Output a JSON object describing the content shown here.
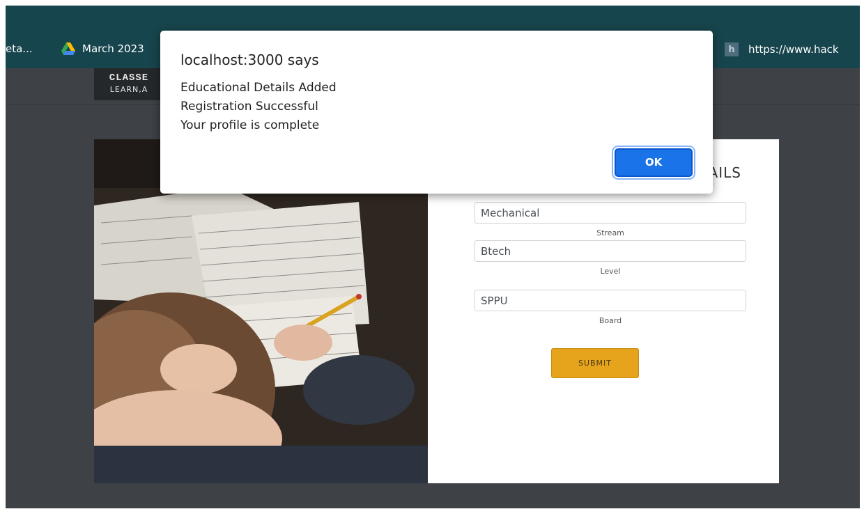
{
  "bookmarks": [
    {
      "label": "eta..."
    },
    {
      "label": "March 2023",
      "icon": "google-drive-icon"
    },
    {
      "label": "https://www.hack",
      "icon": "hackerrank-icon",
      "icon_letter": "h"
    }
  ],
  "logo": {
    "title": "CLASSE",
    "subtitle": "LEARN,A"
  },
  "form": {
    "heading": "AILS",
    "fields": [
      {
        "value": "Mechanical",
        "label": "Stream"
      },
      {
        "value": "Btech",
        "label": "Level"
      },
      {
        "value": "SPPU",
        "label": "Board"
      }
    ],
    "submit_label": "SUBMIT"
  },
  "dialog": {
    "title": "localhost:3000 says",
    "message_lines": [
      "Educational Details Added",
      "Registration Successful",
      "Your profile is complete"
    ],
    "ok_label": "OK"
  },
  "colors": {
    "browser_bar": "#17454d",
    "page_background": "#3e4247",
    "submit_accent": "#e6a41d",
    "ok_button": "#1a73e8"
  }
}
